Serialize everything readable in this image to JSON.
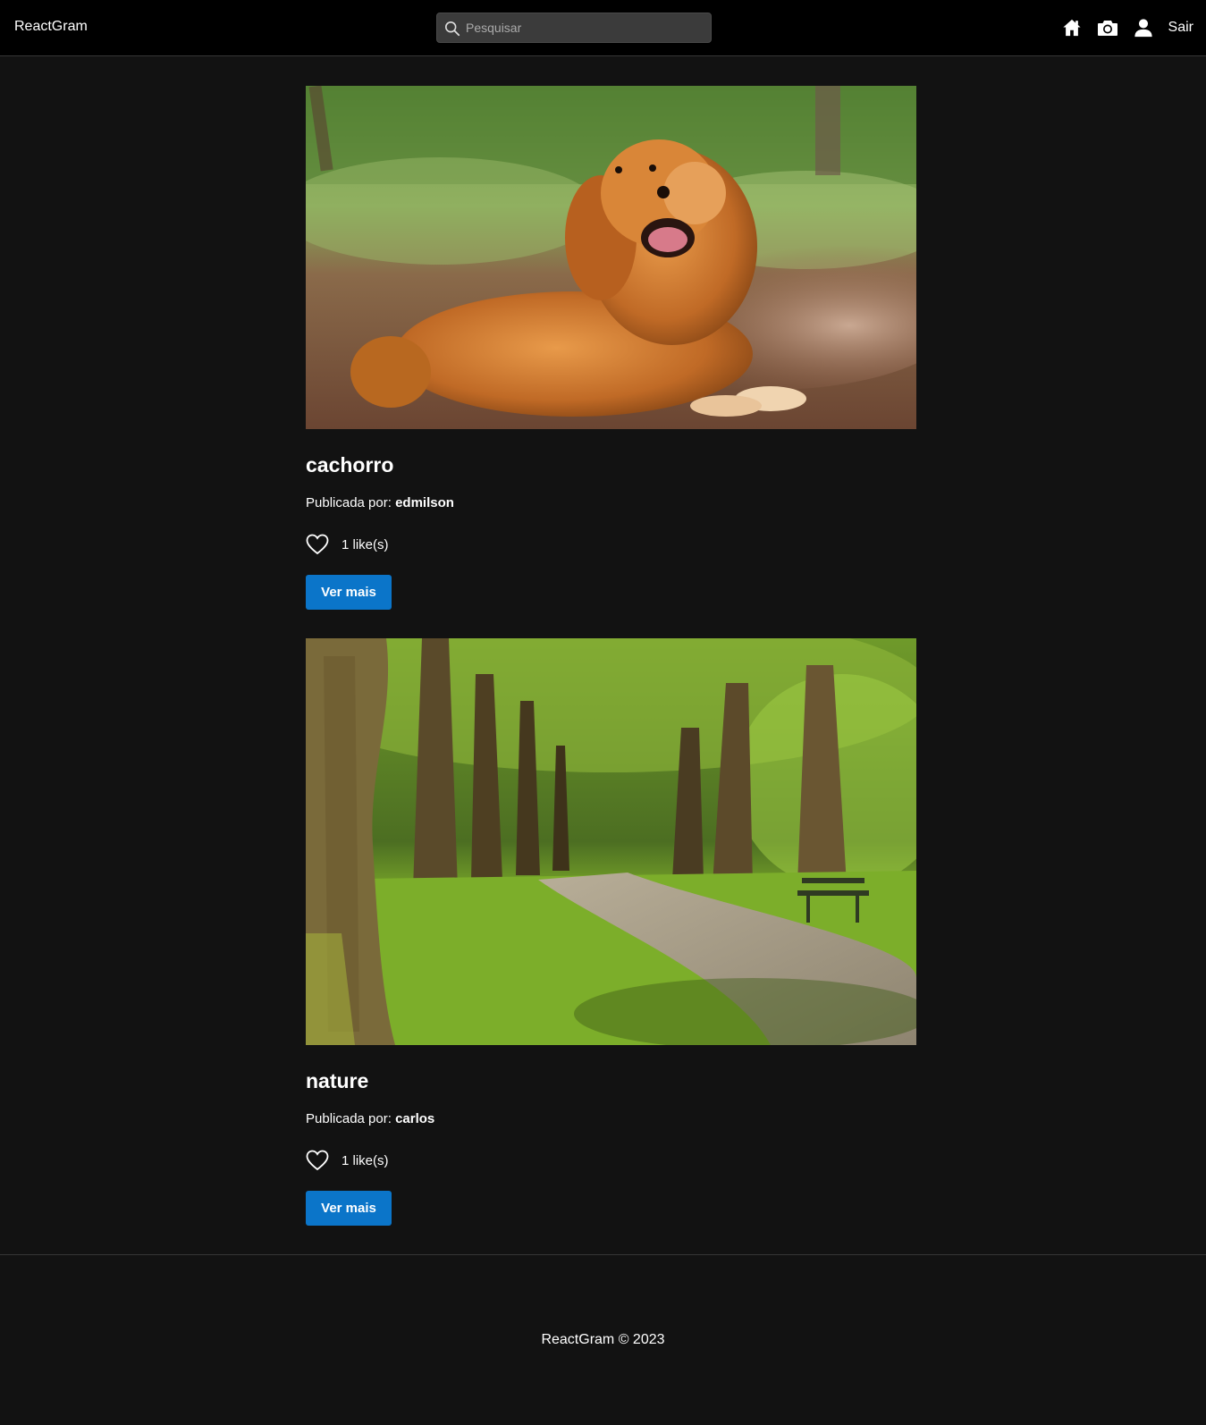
{
  "navbar": {
    "brand": "ReactGram",
    "search_placeholder": "Pesquisar",
    "icons": [
      "home-icon",
      "camera-icon",
      "user-icon"
    ],
    "logout_label": "Sair"
  },
  "posts": [
    {
      "title": "cachorro",
      "author_prefix": "Publicada por:",
      "author": "edmilson",
      "likes_label": "1 like(s)",
      "button_label": "Ver mais"
    },
    {
      "title": "nature",
      "author_prefix": "Publicada por:",
      "author": "carlos",
      "likes_label": "1 like(s)",
      "button_label": "Ver mais"
    }
  ],
  "footer": {
    "text": "ReactGram © 2023"
  },
  "colors": {
    "background": "#121212",
    "navbar": "#000000",
    "button": "#0b75c9"
  }
}
